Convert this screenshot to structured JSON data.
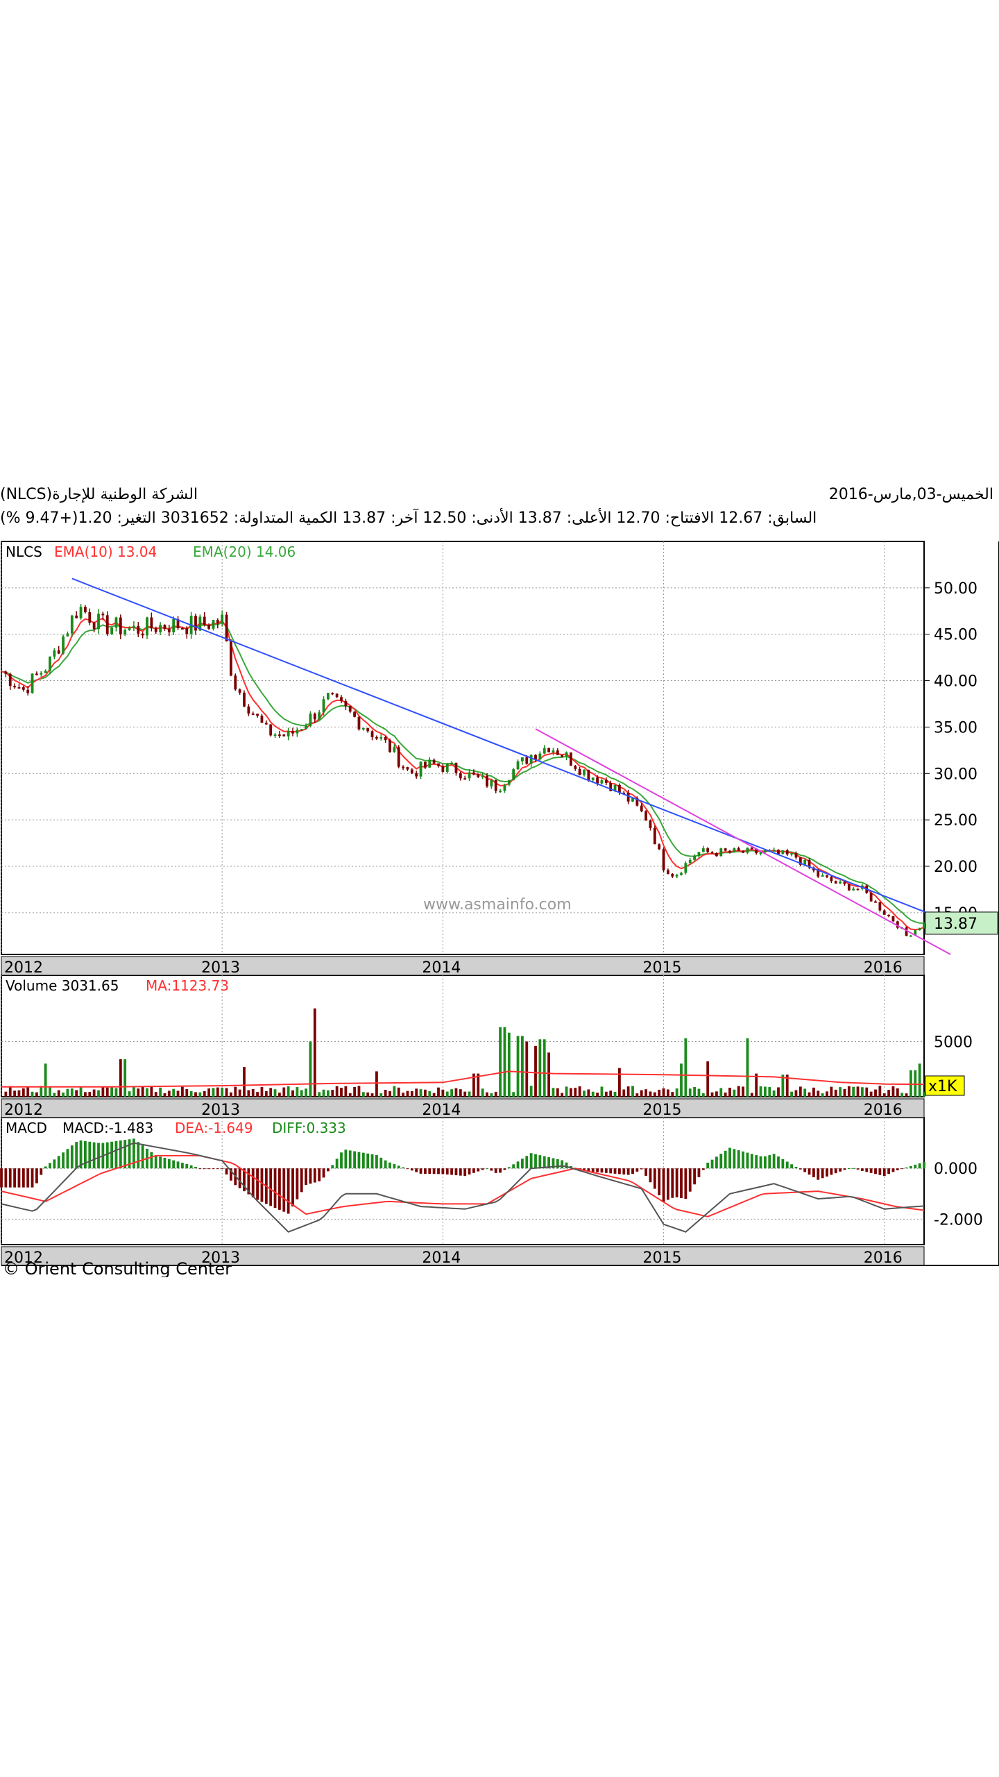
{
  "header": {
    "company": "الشركة الوطنية للإجارة(NLCS)",
    "date": "الخميس-03,مارس-2016",
    "quote_line": "السابق: 12.67 الافتتاح: 12.70 الأعلى: 13.87 الأدنى: 12.50 آخر: 13.87 الكمية المتداولة: 3031652 التغير: 1.20(+9.47 %)"
  },
  "colors": {
    "up": "#1a8a1a",
    "down": "#7a0000",
    "ema10": "#ff3030",
    "ema20": "#3aa83a",
    "trend_blue": "#3050ff",
    "trend_magenta": "#e040e0",
    "macd": "#555555",
    "dea": "#ff3030",
    "diff": "#1a8a1a",
    "last_price_bg": "#c8f0c8",
    "unit_badge_bg": "#ffff00"
  },
  "watermark": "www.asmainfo.com",
  "footer": "© Orient Consulting Center",
  "chart_data": [
    {
      "type": "candlestick",
      "panel": "price",
      "legend": {
        "symbol": "NLCS",
        "ema10": "EMA(10)",
        "ema10_value": "13.04",
        "ema20": "EMA(20)",
        "ema20_value": "14.06"
      },
      "ylim": [
        10.5,
        55
      ],
      "y_ticks": [
        "50.00",
        "45.00",
        "40.00",
        "35.00",
        "30.00",
        "25.00",
        "20.00",
        "15.00"
      ],
      "y_tick_values": [
        50,
        45,
        40,
        35,
        30,
        25,
        20,
        15
      ],
      "x_tick_labels": [
        "2012",
        "2013",
        "2014",
        "2015",
        "2016"
      ],
      "x_tick_years": [
        2012.0,
        2013.0,
        2014.0,
        2015.0,
        2016.0
      ],
      "x_range": [
        2012.0,
        2016.18
      ],
      "last_price": "13.87",
      "series": [
        {
          "name": "NLCS",
          "anchors_x": [
            2012.0,
            2012.1,
            2012.22,
            2012.35,
            2012.45,
            2012.6,
            2012.75,
            2012.9,
            2013.0,
            2013.05,
            2013.1,
            2013.2,
            2013.3,
            2013.4,
            2013.48,
            2013.55,
            2013.65,
            2013.75,
            2013.85,
            2013.95,
            2014.05,
            2014.15,
            2014.25,
            2014.3,
            2014.4,
            2014.48,
            2014.55,
            2014.65,
            2014.75,
            2014.85,
            2014.93,
            2015.0,
            2015.05,
            2015.15,
            2015.3,
            2015.45,
            2015.6,
            2015.7,
            2015.8,
            2015.9,
            2016.0,
            2016.05,
            2016.1,
            2016.18
          ],
          "anchors_y": [
            41,
            39,
            42,
            48,
            46,
            45.5,
            46,
            46,
            46.5,
            40,
            38,
            34.5,
            34,
            36,
            38,
            37,
            35,
            33,
            30,
            31,
            30.5,
            29.5,
            28.5,
            30,
            32,
            33,
            32,
            30,
            29,
            27,
            25,
            20,
            19,
            21.5,
            21.5,
            21.5,
            21,
            19,
            18,
            17.5,
            15,
            14,
            12.5,
            13.87
          ]
        },
        {
          "name": "EMA(10)"
        },
        {
          "name": "EMA(20)"
        }
      ],
      "trendlines": [
        {
          "color": "blue",
          "from": [
            2012.32,
            51
          ],
          "to": [
            2016.3,
            14
          ]
        },
        {
          "color": "magenta",
          "from": [
            2014.42,
            34.8
          ],
          "to": [
            2016.3,
            10.5
          ]
        }
      ]
    },
    {
      "type": "bar",
      "panel": "volume",
      "legend": {
        "label": "Volume",
        "value": "3031.65",
        "ma_label": "MA:",
        "ma_value": "1123.73"
      },
      "unit": "x1K",
      "ylim": [
        0,
        11000
      ],
      "y_ticks": [
        "5000"
      ],
      "y_tick_values": [
        5000
      ],
      "x_tick_labels": [
        "2012",
        "2013",
        "2014",
        "2015",
        "2016"
      ],
      "spikes": [
        {
          "x": 2012.2,
          "v": 3000
        },
        {
          "x": 2012.55,
          "v": 3400
        },
        {
          "x": 2013.42,
          "v": 8000
        },
        {
          "x": 2013.4,
          "v": 5000
        },
        {
          "x": 2013.1,
          "v": 2700
        },
        {
          "x": 2013.7,
          "v": 2300
        },
        {
          "x": 2014.27,
          "v": 6300
        },
        {
          "x": 2014.3,
          "v": 5800
        },
        {
          "x": 2014.35,
          "v": 5500
        },
        {
          "x": 2014.38,
          "v": 5000
        },
        {
          "x": 2014.42,
          "v": 4600
        },
        {
          "x": 2014.45,
          "v": 5200
        },
        {
          "x": 2014.48,
          "v": 4000
        },
        {
          "x": 2014.15,
          "v": 2100
        },
        {
          "x": 2014.8,
          "v": 2600
        },
        {
          "x": 2015.08,
          "v": 3000
        },
        {
          "x": 2015.1,
          "v": 5300
        },
        {
          "x": 2015.2,
          "v": 3200
        },
        {
          "x": 2015.38,
          "v": 5300
        },
        {
          "x": 2015.42,
          "v": 2100
        },
        {
          "x": 2015.55,
          "v": 2000
        },
        {
          "x": 2016.13,
          "v": 2400
        },
        {
          "x": 2016.16,
          "v": 3000
        }
      ],
      "ma_points": [
        [
          2012.0,
          900
        ],
        [
          2012.5,
          900
        ],
        [
          2013.0,
          1000
        ],
        [
          2013.5,
          1200
        ],
        [
          2014.0,
          1300
        ],
        [
          2014.3,
          2300
        ],
        [
          2014.5,
          2100
        ],
        [
          2015.0,
          2000
        ],
        [
          2015.5,
          1800
        ],
        [
          2015.8,
          1300
        ],
        [
          2016.0,
          1150
        ],
        [
          2016.18,
          1124
        ]
      ]
    },
    {
      "type": "line",
      "panel": "macd",
      "legend": {
        "label": "MACD",
        "macd": "MACD:-1.483",
        "dea": "DEA:-1.649",
        "diff": "DIFF:0.333"
      },
      "ylim": [
        -3.0,
        2.0
      ],
      "y_ticks": [
        "0.000",
        "-2.000"
      ],
      "y_tick_values": [
        0,
        -2
      ],
      "x_tick_labels": [
        "2012",
        "2013",
        "2014",
        "2015",
        "2016"
      ],
      "macd_anchors": [
        [
          2012.0,
          -1.4
        ],
        [
          2012.15,
          -1.7
        ],
        [
          2012.35,
          0.1
        ],
        [
          2012.6,
          1.0
        ],
        [
          2012.85,
          0.6
        ],
        [
          2013.0,
          0.3
        ],
        [
          2013.15,
          -1.2
        ],
        [
          2013.3,
          -2.5
        ],
        [
          2013.45,
          -2.0
        ],
        [
          2013.55,
          -1.0
        ],
        [
          2013.7,
          -1.0
        ],
        [
          2013.9,
          -1.5
        ],
        [
          2014.1,
          -1.6
        ],
        [
          2014.25,
          -1.3
        ],
        [
          2014.4,
          0.0
        ],
        [
          2014.55,
          0.1
        ],
        [
          2014.7,
          -0.3
        ],
        [
          2014.9,
          -0.8
        ],
        [
          2015.0,
          -2.2
        ],
        [
          2015.1,
          -2.5
        ],
        [
          2015.3,
          -1.0
        ],
        [
          2015.5,
          -0.6
        ],
        [
          2015.7,
          -1.2
        ],
        [
          2015.85,
          -1.1
        ],
        [
          2016.0,
          -1.6
        ],
        [
          2016.18,
          -1.48
        ]
      ],
      "dea_anchors": [
        [
          2012.0,
          -0.9
        ],
        [
          2012.2,
          -1.3
        ],
        [
          2012.45,
          -0.2
        ],
        [
          2012.7,
          0.5
        ],
        [
          2012.9,
          0.5
        ],
        [
          2013.05,
          0.2
        ],
        [
          2013.2,
          -0.7
        ],
        [
          2013.38,
          -1.8
        ],
        [
          2013.55,
          -1.5
        ],
        [
          2013.75,
          -1.3
        ],
        [
          2014.0,
          -1.4
        ],
        [
          2014.2,
          -1.4
        ],
        [
          2014.4,
          -0.4
        ],
        [
          2014.6,
          0.0
        ],
        [
          2014.85,
          -0.5
        ],
        [
          2015.05,
          -1.6
        ],
        [
          2015.2,
          -1.9
        ],
        [
          2015.45,
          -1.0
        ],
        [
          2015.7,
          -0.9
        ],
        [
          2015.9,
          -1.2
        ],
        [
          2016.05,
          -1.5
        ],
        [
          2016.18,
          -1.65
        ]
      ]
    }
  ]
}
